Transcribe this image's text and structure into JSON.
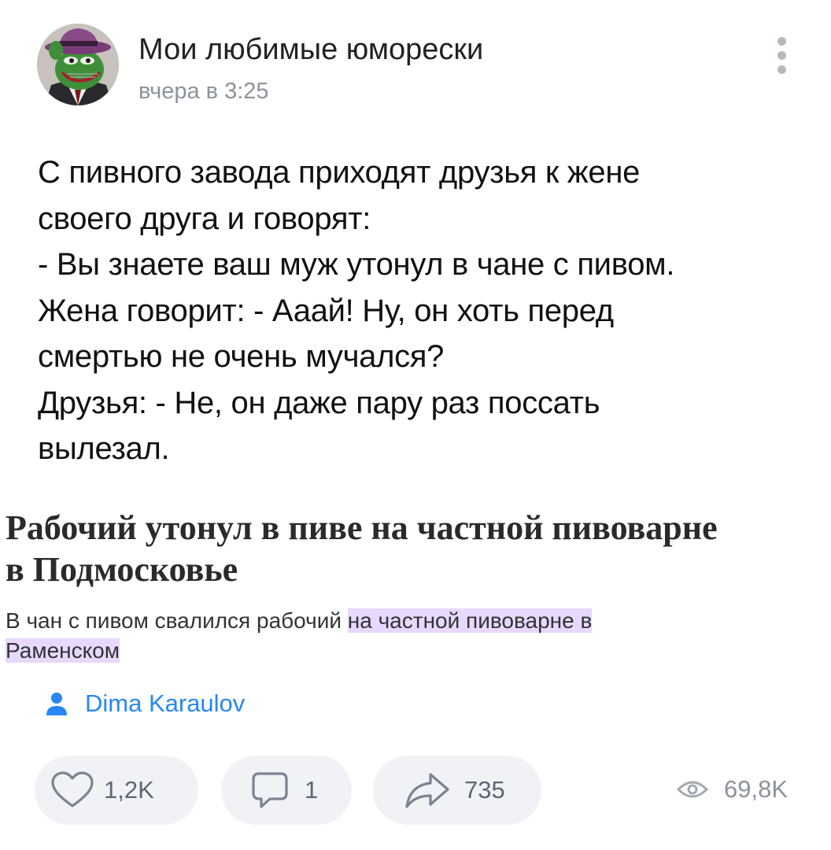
{
  "post": {
    "group_name": "Мои любимые юморески",
    "time": "вчера в 3:25",
    "text_lines": [
      "С пивного завода приходят друзья к жене",
      "своего друга и говорят:",
      "- Вы знаете ваш муж утонул в чане с пивом.",
      "Жена говорит: - Ааай! Ну, он хоть перед",
      "смертью не очень мучался?",
      "Друзья: - Не, он даже пару раз поссать",
      "вылезал."
    ]
  },
  "news": {
    "title_lines": [
      "Рабочий утонул в пиве на частной пивоварне",
      "в Подмосковье"
    ],
    "lead_plain": "В чан с пивом свалился рабочий ",
    "lead_highlight_1": "на частной пивоварне в",
    "lead_highlight_2": "Раменском",
    "highlight_color": "#e7d8ff"
  },
  "author": {
    "name": "Dima Karaulov",
    "icon": "user-icon"
  },
  "actions": {
    "likes": "1,2K",
    "comments": "1",
    "shares": "735",
    "views": "69,8K"
  },
  "colors": {
    "link": "#2787f5",
    "secondary_text": "#8c939c",
    "button_bg": "#f0f2f5"
  }
}
